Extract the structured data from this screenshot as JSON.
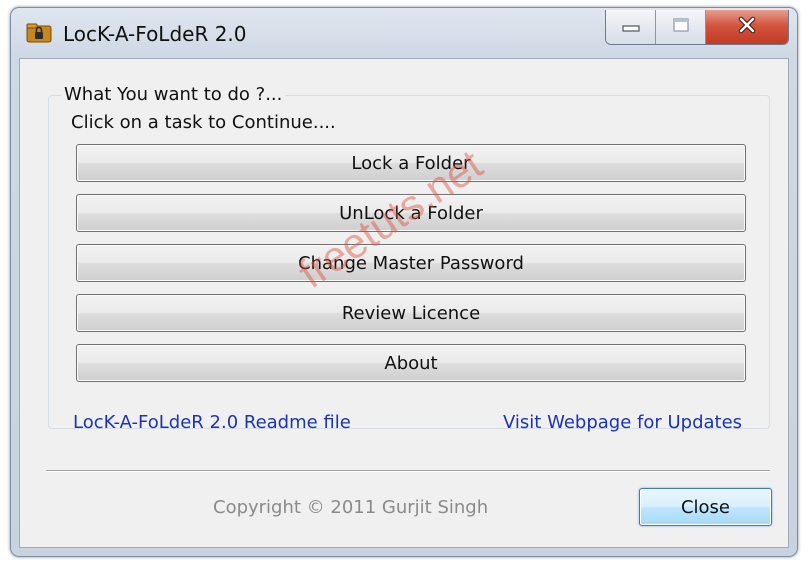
{
  "window": {
    "title": "LocK-A-FoLdeR 2.0",
    "icons": {
      "app": "lock-folder-icon",
      "minimize": "minimize-icon",
      "maximize": "maximize-icon",
      "close": "close-x-icon"
    }
  },
  "group": {
    "caption": "What You want to do ?...",
    "subcaption": "Click on a task to Continue...."
  },
  "tasks": [
    {
      "label": "Lock a Folder"
    },
    {
      "label": "UnLock a Folder"
    },
    {
      "label": "Change Master Password"
    },
    {
      "label": "Review Licence"
    },
    {
      "label": "About"
    }
  ],
  "links": {
    "readme": "LocK-A-FoLdeR 2.0 Readme file",
    "webpage": "Visit Webpage for Updates"
  },
  "footer": {
    "copyright": "Copyright © 2011 Gurjit Singh",
    "close_label": "Close"
  },
  "watermark": "freetuts.net",
  "colors": {
    "link": "#1a33b8",
    "close_caption": "#c23a24",
    "focused_button": "#bee6fd",
    "watermark": "#dc503c"
  }
}
